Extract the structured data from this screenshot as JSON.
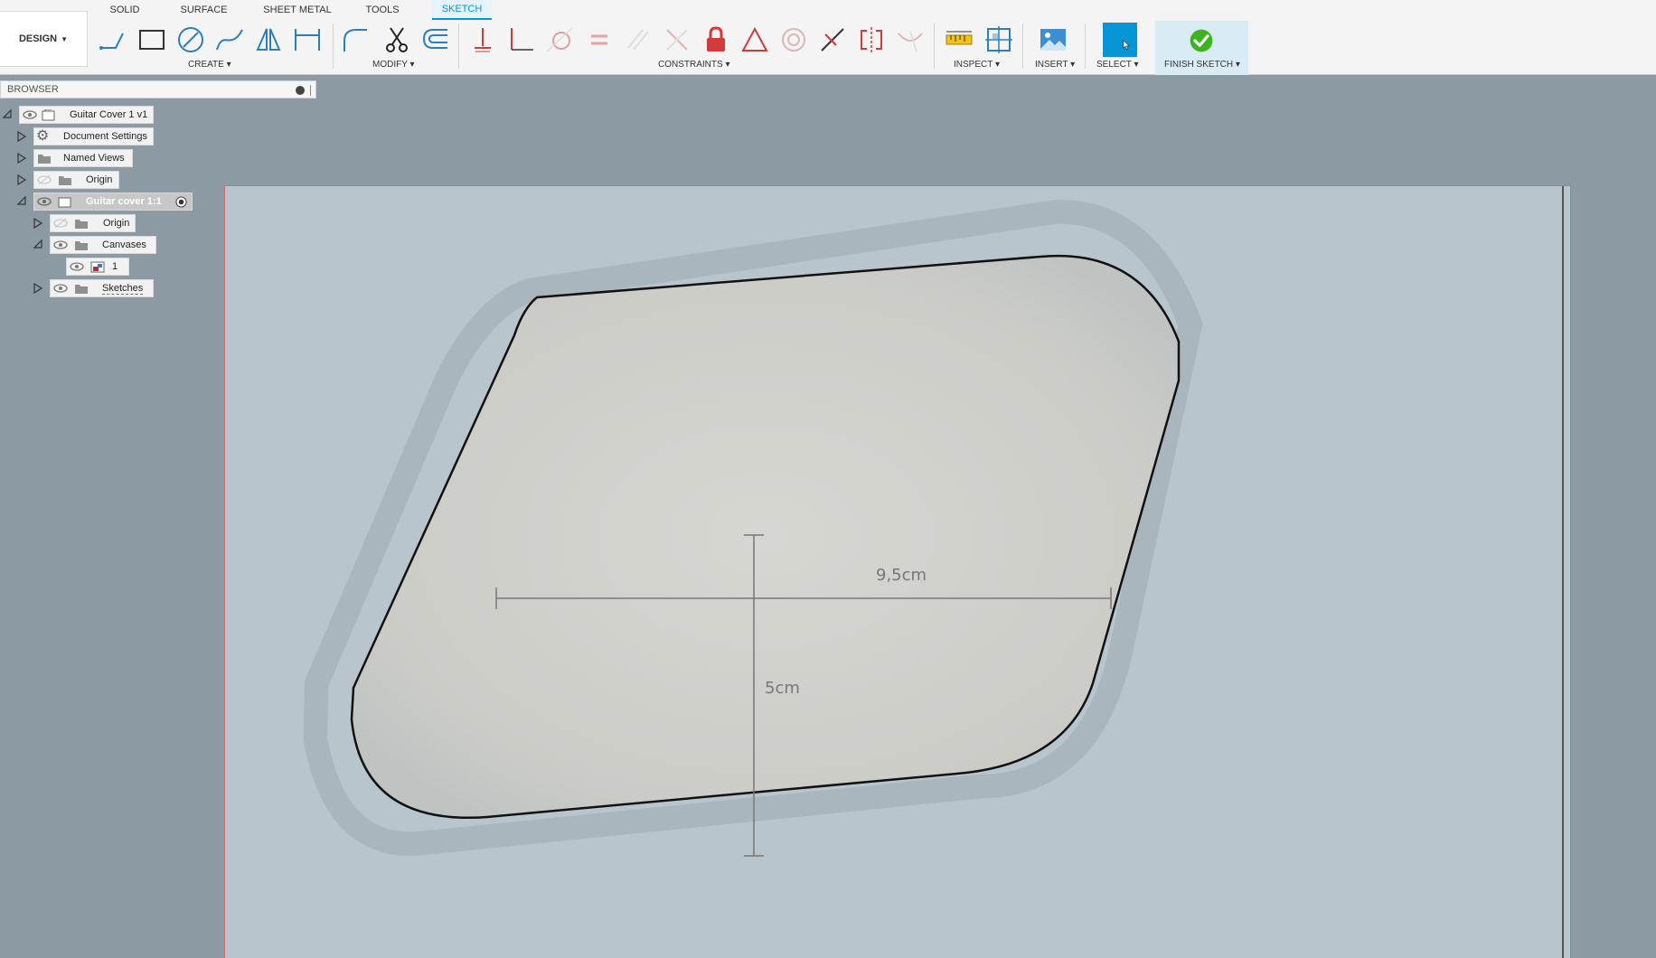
{
  "workspace": {
    "label": "DESIGN"
  },
  "tabs": [
    {
      "label": "SOLID",
      "active": false
    },
    {
      "label": "SURFACE",
      "active": false
    },
    {
      "label": "SHEET METAL",
      "active": false
    },
    {
      "label": "TOOLS",
      "active": false
    },
    {
      "label": "SKETCH",
      "active": true
    }
  ],
  "groups": {
    "create": "CREATE",
    "modify": "MODIFY",
    "constraints": "CONSTRAINTS",
    "inspect": "INSPECT",
    "insert": "INSERT",
    "select": "SELECT",
    "finish": "FINISH SKETCH"
  },
  "browser": {
    "title": "BROWSER",
    "items": [
      {
        "label": "Guitar Cover 1 v1"
      },
      {
        "label": "Document Settings"
      },
      {
        "label": "Named Views"
      },
      {
        "label": "Origin"
      },
      {
        "label": "Guitar cover 1:1"
      },
      {
        "label": "Origin"
      },
      {
        "label": "Canvases"
      },
      {
        "label": "1"
      },
      {
        "label": "Sketches"
      }
    ]
  },
  "sketch": {
    "width_annotation": "9,5cm",
    "height_annotation": "5cm"
  },
  "colors": {
    "accent": "#0696d7",
    "select_button": "#0696d7",
    "finish_check": "#3db41e",
    "constraint_red": "#d33a3a",
    "canvas_border": "#d86a6a"
  }
}
